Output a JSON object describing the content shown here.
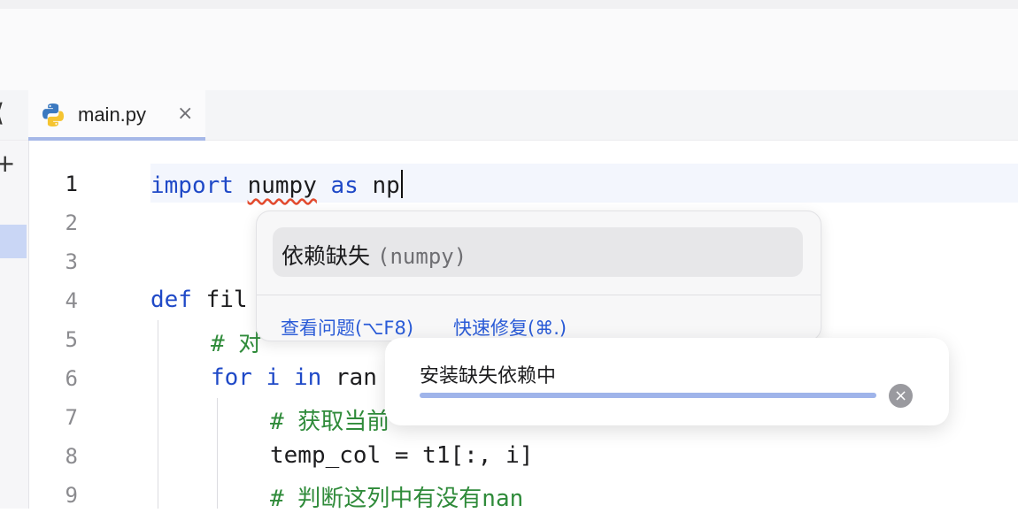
{
  "tab": {
    "label": "main.py",
    "close": "×",
    "icon": "python-icon"
  },
  "toolbar": {
    "collapse": "⟨",
    "add": "+"
  },
  "code": {
    "line_numbers": [
      "1",
      "2",
      "3",
      "4",
      "5",
      "6",
      "7",
      "8",
      "9"
    ],
    "line1": {
      "kw1": "import",
      "mod": "numpy",
      "kw2": "as",
      "alias": "np"
    },
    "line4": {
      "kw": "def",
      "rest": "fil"
    },
    "line5": {
      "comment": "# 对"
    },
    "line6": {
      "kw": "for",
      "var": "i",
      "kw2": "in",
      "rest": "ran"
    },
    "line7": {
      "comment": "# 获取当前"
    },
    "line8": {
      "text": "temp_col = t1[:, i]"
    },
    "line9": {
      "comment": "# 判断这列中有没有nan"
    }
  },
  "popup": {
    "title": "依赖缺失",
    "package": "(numpy)",
    "link_view": "查看问题(⌥F8)",
    "link_fix": "快速修复(⌘.)"
  },
  "toast": {
    "title": "安装缺失依赖中",
    "progress": 1.0,
    "cancel": "×"
  },
  "colors": {
    "keyword": "#1f49c7",
    "comment": "#2f8b3a",
    "link": "#2a5bd7",
    "error_squiggle": "#e34b2e"
  }
}
